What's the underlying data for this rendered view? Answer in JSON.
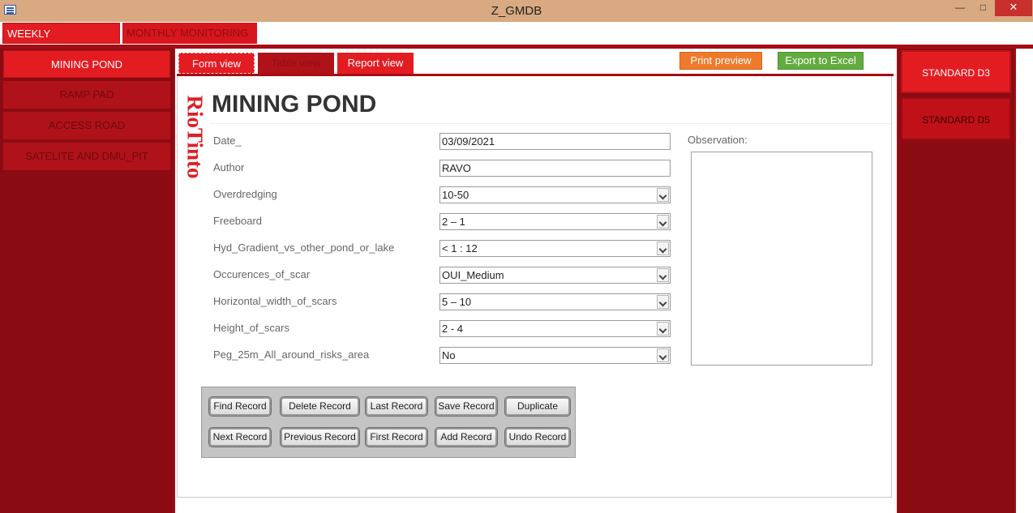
{
  "window": {
    "title": "Z_GMDB"
  },
  "top_tabs": [
    {
      "label": "WEEKLY MONITORING",
      "active": true
    },
    {
      "label": "MONTHLY MONITORING",
      "active": false
    }
  ],
  "left_nav": [
    {
      "label": "MINING POND",
      "active": true
    },
    {
      "label": "RAMP PAD",
      "active": false
    },
    {
      "label": "ACCESS ROAD",
      "active": false
    },
    {
      "label": "SATELITE AND DMU_PIT",
      "active": false
    }
  ],
  "sub_tabs": [
    {
      "label": "Form view",
      "active": true
    },
    {
      "label": "Table view",
      "active": false
    },
    {
      "label": "Report view",
      "active": false
    }
  ],
  "actions": {
    "print_preview": "Print preview",
    "export_excel": "Export to Excel"
  },
  "logo": {
    "text": "RioTinto"
  },
  "form": {
    "title": "MINING POND",
    "fields": [
      {
        "label": "Date_",
        "value": "03/09/2021",
        "type": "text"
      },
      {
        "label": "Author",
        "value": "RAVO",
        "type": "text"
      },
      {
        "label": "Overdredging",
        "value": "10-50",
        "type": "select"
      },
      {
        "label": "Freeboard",
        "value": "2 – 1",
        "type": "select"
      },
      {
        "label": "Hyd_Gradient_vs_other_pond_or_lake",
        "value": "< 1 : 12",
        "type": "select"
      },
      {
        "label": "Occurences_of_scar",
        "value": "OUI_Medium",
        "type": "select"
      },
      {
        "label": "Horizontal_width_of_scars",
        "value": "5 – 10",
        "type": "select"
      },
      {
        "label": "Height_of_scars",
        "value": "2 - 4",
        "type": "select"
      },
      {
        "label": "Peg_25m_All_around_risks_area",
        "value": "No",
        "type": "select"
      }
    ],
    "observation_label": "Observation:",
    "observation_value": ""
  },
  "record_buttons": [
    [
      "Find Record",
      "Delete Record",
      "Last Record",
      "Save Record",
      "Duplicate"
    ],
    [
      "Next Record",
      "Previous Record",
      "First Record",
      "Add Record",
      "Undo Record"
    ]
  ],
  "standards": [
    {
      "label": "STANDARD D3",
      "active": true
    },
    {
      "label": "STANDARD D5",
      "active": false
    }
  ],
  "colors": {
    "accent": "#e31c22",
    "dark_red": "#8a0c12",
    "title_bar": "#d9a982"
  }
}
